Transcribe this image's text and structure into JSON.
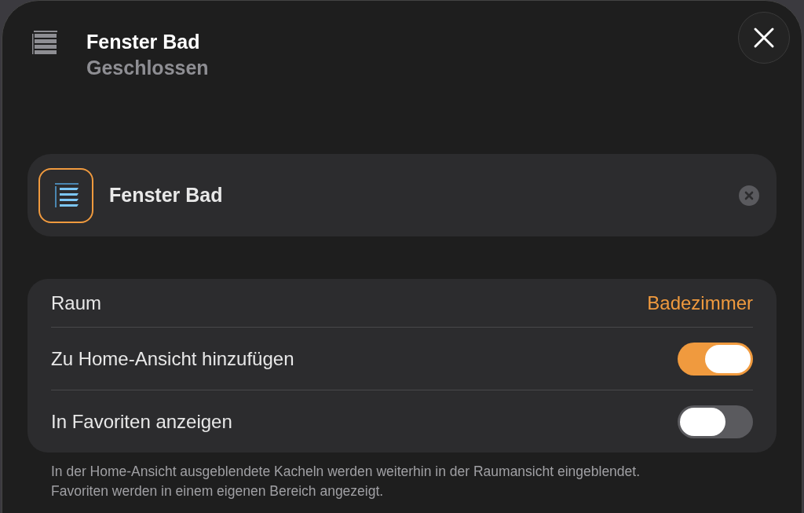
{
  "header": {
    "title": "Fenster Bad",
    "status": "Geschlossen"
  },
  "name_field": {
    "value": "Fenster Bad"
  },
  "settings": [
    {
      "kind": "value",
      "label": "Raum",
      "value": "Badezimmer"
    },
    {
      "kind": "toggle",
      "label": "Zu Home-Ansicht hinzufügen",
      "on": true
    },
    {
      "kind": "toggle",
      "label": "In Favoriten anzeigen",
      "on": false
    }
  ],
  "footnote": "In der Home-Ansicht ausgeblendete Kacheln werden weiterhin in der Raumansicht eingeblendet. Favoriten werden in einem eigenen Bereich angezeigt."
}
